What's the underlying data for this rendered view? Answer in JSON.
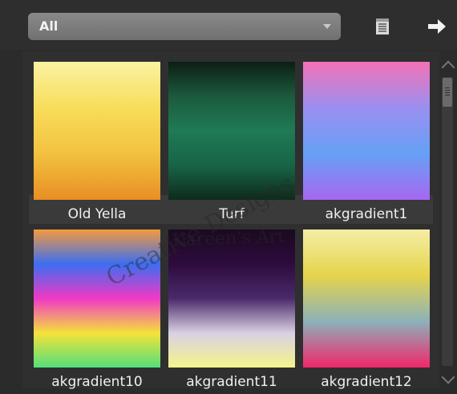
{
  "filter": {
    "selected": "All"
  },
  "icons": {
    "document": "document-icon",
    "export": "arrow-right-icon",
    "dropdown": "chevron-down-icon"
  },
  "gradients": [
    {
      "name": "Old Yella",
      "colors": [
        "#fbf3a3",
        "#f8dd5b",
        "#f2c23f",
        "#e98e24"
      ]
    },
    {
      "name": "Turf",
      "colors": [
        "#0d1e14",
        "#1b5a3d",
        "#1f7a55",
        "#186446",
        "#0f2a1c"
      ]
    },
    {
      "name": "akgradient1",
      "colors": [
        "#f472b6",
        "#9a8ff0",
        "#66a0f5",
        "#a767f2"
      ]
    },
    {
      "name": "akgradient10",
      "colors": [
        "#f59a3e",
        "#3b6ef0",
        "#f039c6",
        "#f5e23a",
        "#53e07a"
      ]
    },
    {
      "name": "akgradient11",
      "colors": [
        "#1a0a1f",
        "#2d0b3e",
        "#4a2a6b",
        "#d9d0e3",
        "#f4f58a"
      ]
    },
    {
      "name": "akgradient12",
      "colors": [
        "#f5eda6",
        "#e5d44c",
        "#8cb1ba",
        "#f0266a"
      ]
    }
  ],
  "watermark": {
    "line1": "Creative Designs",
    "line2": "Kareen's Art"
  }
}
